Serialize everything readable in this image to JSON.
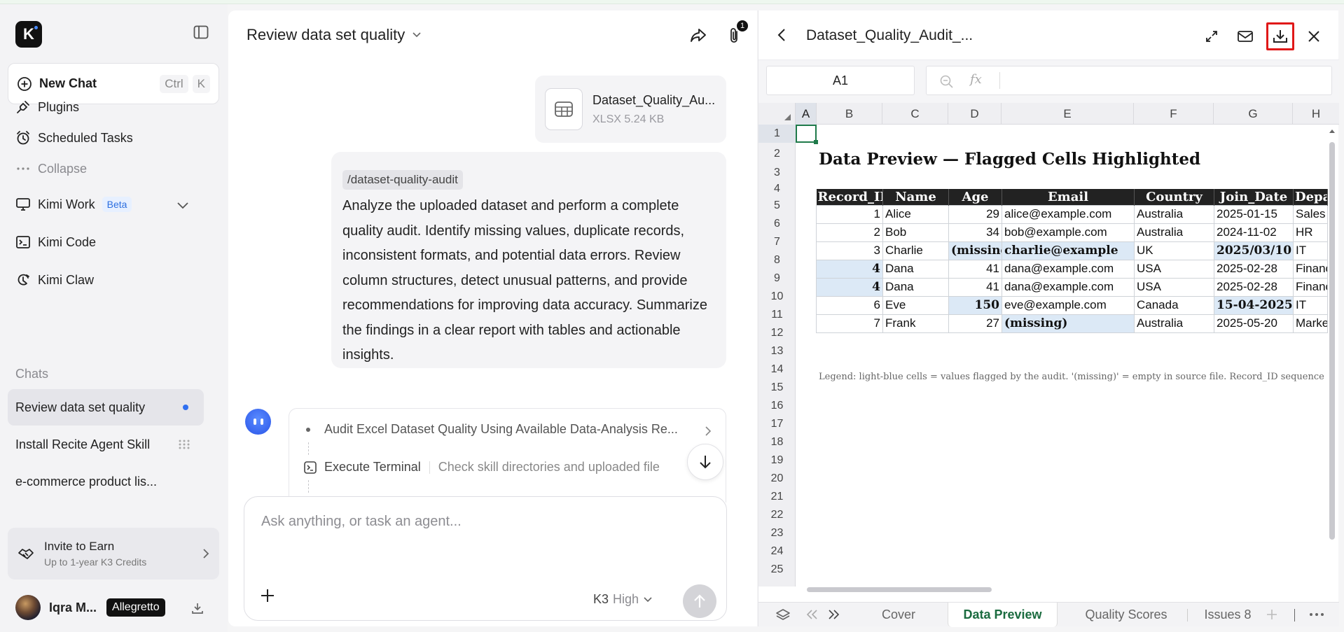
{
  "sidebar": {
    "logo_letter": "K",
    "new_chat": {
      "label": "New Chat",
      "shortcut": [
        "Ctrl",
        "K"
      ]
    },
    "nav": [
      {
        "label": "Plugins",
        "icon": "plug-icon"
      },
      {
        "label": "Scheduled Tasks",
        "icon": "alarm-clock-icon"
      },
      {
        "label": "Collapse",
        "icon": "more-dots-icon"
      },
      {
        "label": "Kimi Work",
        "badge": "Beta",
        "icon": "monitor-icon"
      },
      {
        "label": "Kimi Code",
        "icon": "terminal-icon"
      },
      {
        "label": "Kimi Claw",
        "icon": "claw-icon"
      }
    ],
    "chats_label": "Chats",
    "chats": [
      "Review data set quality",
      "Install Recite Agent Skill",
      "e-commerce product lis..."
    ],
    "invite": {
      "title": "Invite to Earn",
      "subtitle": "Up to 1-year K3 Credits"
    },
    "user": {
      "name": "Iqra M...",
      "plan": "Allegretto"
    }
  },
  "chat": {
    "title": "Review data set quality",
    "attachment_count": "1",
    "file": {
      "name": "Dataset_Quality_Au...",
      "meta": "XLSX 5.24 KB"
    },
    "command": "/dataset-quality-audit",
    "message": "Analyze the uploaded dataset and perform a complete quality audit. Identify missing values, duplicate records, inconsistent formats, and potential data errors. Review column structures, detect unusual patterns, and provide recommendations for improving data accuracy. Summarize the findings in a clear report with tables and actionable insights.",
    "steps": [
      {
        "label": "Audit Excel Dataset Quality Using Available Data-Analysis Re..."
      },
      {
        "label": "Execute Terminal",
        "detail": "Check skill directories and uploaded file"
      }
    ],
    "composer": {
      "placeholder": "Ask anything, or task an agent...",
      "model": "K3",
      "effort": "High"
    }
  },
  "viewer": {
    "title": "Dataset_Quality_Audit_...",
    "name_box": "A1",
    "fx_label": "fx",
    "columns": [
      "A",
      "B",
      "C",
      "D",
      "E",
      "F",
      "G",
      "H"
    ],
    "rows": [
      "1",
      "2",
      "3",
      "4",
      "5",
      "6",
      "7",
      "8",
      "9",
      "10",
      "11",
      "12",
      "13",
      "14",
      "15",
      "16",
      "17",
      "18",
      "19",
      "20",
      "21",
      "22",
      "23",
      "24",
      "25"
    ],
    "sheet_title": "Data Preview — Flagged Cells Highlighted",
    "headers": [
      "Record_ID",
      "Name",
      "Age",
      "Email",
      "Country",
      "Join_Date",
      "Department"
    ],
    "table_rows": [
      [
        "1",
        "Alice",
        "29",
        "alice@example.com",
        "Australia",
        "2025-01-15",
        "Sales"
      ],
      [
        "2",
        "Bob",
        "34",
        "bob@example.com",
        "Australia",
        "2024-11-02",
        "HR"
      ],
      [
        "3",
        "Charlie",
        "(missing)",
        "charlie@example",
        "UK",
        "2025/03/10",
        "IT"
      ],
      [
        "4",
        "Dana",
        "41",
        "dana@example.com",
        "USA",
        "2025-02-28",
        "Finance"
      ],
      [
        "4",
        "Dana",
        "41",
        "dana@example.com",
        "USA",
        "2025-02-28",
        "Finance"
      ],
      [
        "6",
        "Eve",
        "150",
        "eve@example.com",
        "Canada",
        "15-04-2025",
        "IT"
      ],
      [
        "7",
        "Frank",
        "27",
        "(missing)",
        "Australia",
        "2025-05-20",
        "Marketing"
      ]
    ],
    "legend": "Legend: light-blue cells = values flagged by the audit. '(missing)' = empty in source file. Record_ID sequence",
    "tabs": [
      "Cover",
      "Data Preview",
      "Quality Scores",
      "Issues 8"
    ],
    "active_tab": "Data Preview",
    "flag_color": "#dce9f6",
    "accent_color": "#1a6b3f"
  }
}
